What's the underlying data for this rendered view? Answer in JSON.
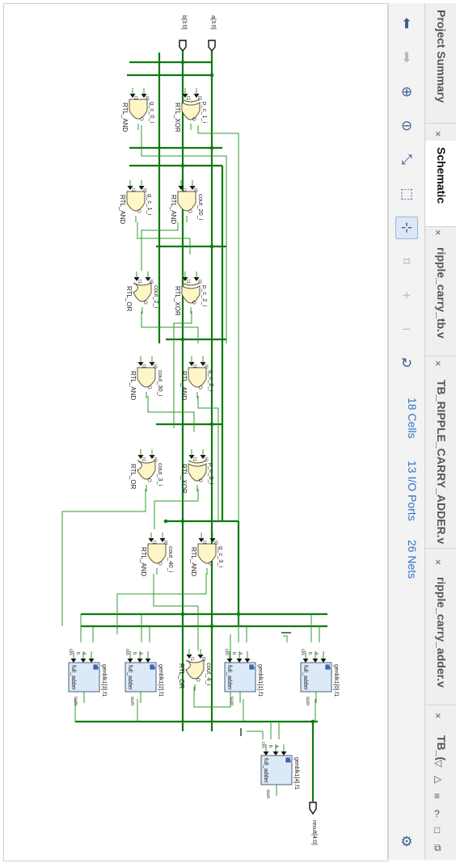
{
  "tabs": [
    {
      "label": "Project Summary",
      "active": false
    },
    {
      "label": "Schematic",
      "active": true
    },
    {
      "label": "ripple_carry_tb.v",
      "active": false
    },
    {
      "label": "TB_RIPPLE_CARRY_ADDER.v",
      "active": false
    },
    {
      "label": "ripple_carry_adder.v",
      "active": false
    },
    {
      "label": "TB_(",
      "active": false
    }
  ],
  "tab_controls": {
    "close": "×",
    "left": "◁",
    "right": "▷",
    "menu": "≡",
    "help": "?",
    "restore": "□",
    "float": "⧉"
  },
  "toolbar": {
    "icons": [
      "previous-icon",
      "next-icon",
      "zoom-in-icon",
      "zoom-out-icon",
      "zoom-fit-icon",
      "zoom-area-icon",
      "select-mode-icon",
      "autofit-selection-icon",
      "expand-icon",
      "collapse-icon",
      "regenerate-icon",
      "settings-icon"
    ],
    "stats": {
      "cells": "18 Cells",
      "io_ports": "13 I/O Ports",
      "nets": "26 Nets"
    }
  },
  "schematic": {
    "ports": {
      "b": "b[3:0]",
      "a": "a[3:0]",
      "result": "result[4:0]"
    },
    "gates": [
      {
        "id": "g_c_0_i",
        "type": "RTL_AND"
      },
      {
        "id": "p_c_1_i",
        "type": "RTL_XOR"
      },
      {
        "id": "g_c_1_i",
        "type": "RTL_AND"
      },
      {
        "id": "cout_20_i",
        "type": "RTL_AND"
      },
      {
        "id": "cout_2_i",
        "type": "RTL_OR"
      },
      {
        "id": "p_c_2_i",
        "type": "RTL_XOR"
      },
      {
        "id": "cout_30_i",
        "type": "RTL_AND"
      },
      {
        "id": "g_c_2_i",
        "type": "RTL_AND"
      },
      {
        "id": "cout_3_i",
        "type": "RTL_OR"
      },
      {
        "id": "p_c_3_i",
        "type": "RTL_XOR"
      },
      {
        "id": "cout_40_i",
        "type": "RTL_AND"
      },
      {
        "id": "g_c_3_i",
        "type": "RTL_AND"
      },
      {
        "id": "cout_4_i",
        "type": "RTL_OR"
      }
    ],
    "blocks": [
      {
        "inst": "genblk1[3].f1",
        "cell": "full_adder"
      },
      {
        "inst": "genblk1[2].f1",
        "cell": "full_adder"
      },
      {
        "inst": "genblk1[1].f1",
        "cell": "full_adder"
      },
      {
        "inst": "genblk1[0].f1",
        "cell": "full_adder"
      },
      {
        "inst": "genblk1[4].f1",
        "cell": "full_adder"
      }
    ],
    "pins": {
      "i0": "I0",
      "i1": "I1",
      "o": "O",
      "a": "a",
      "b": "b",
      "cin": "cin",
      "sum": "sum",
      "plus": "+"
    }
  },
  "colors": {
    "wire": "#2d9b2d",
    "bus": "#0f7a0f",
    "gate_fill": "#fff6c8",
    "gate_stroke": "#5e5a40",
    "block_fill": "#dce9f8",
    "block_stroke": "#4d5f78",
    "accent": "#2f73c7"
  }
}
